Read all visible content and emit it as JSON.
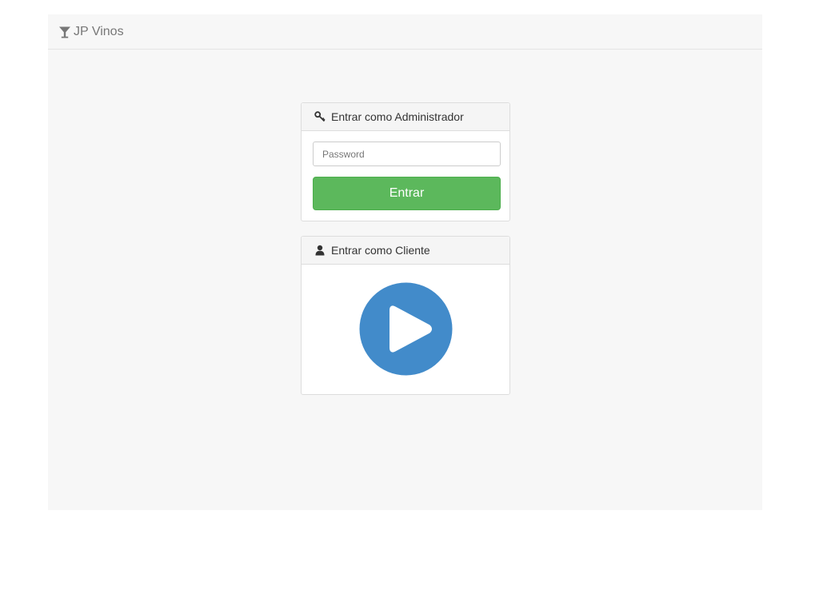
{
  "navbar": {
    "brand_label": "JP Vinos",
    "brand_icon": "glass-icon"
  },
  "admin_panel": {
    "title": "Entrar como Administrador",
    "icon": "key-icon",
    "password_placeholder": "Password",
    "password_value": "",
    "submit_label": "Entrar",
    "submit_color": "#5cb85c"
  },
  "client_panel": {
    "title": "Entrar como Cliente",
    "icon": "user-icon",
    "play_icon": "play-circle-icon",
    "play_color": "#428bca"
  }
}
